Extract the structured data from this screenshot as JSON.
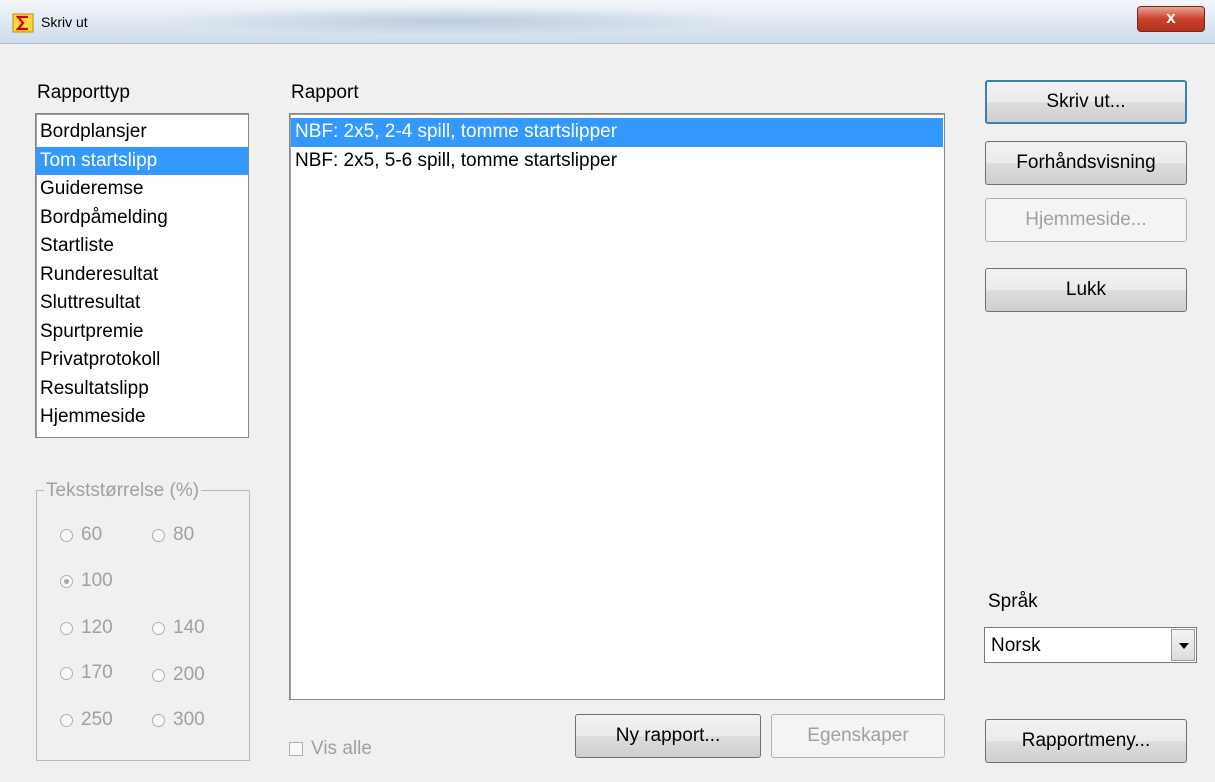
{
  "window": {
    "title": "Skriv ut",
    "close_glyph": "x",
    "icon": "sigma-icon"
  },
  "report_type": {
    "label": "Rapporttyp",
    "items": [
      "Bordplansjer",
      "Tom startslipp",
      "Guideremse",
      "Bordpåmelding",
      "Startliste",
      "Runderesultat",
      "Sluttresultat",
      "Spurtpremie",
      "Privatprotokoll",
      "Resultatslipp",
      "Hjemmeside"
    ],
    "selected": "Tom startslipp"
  },
  "report": {
    "label": "Rapport",
    "items": [
      "NBF: 2x5, 2-4 spill, tomme startslipper",
      "NBF: 2x5, 5-6 spill, tomme startslipper"
    ],
    "selected": "NBF: 2x5, 2-4 spill, tomme startslipper"
  },
  "text_size": {
    "label": "Tekststørrelse (%)",
    "options": [
      "60",
      "80",
      "100",
      "120",
      "140",
      "170",
      "200",
      "250",
      "300"
    ],
    "selected": "100"
  },
  "show_all": {
    "label": "Vis alle",
    "checked": false
  },
  "buttons": {
    "print": "Skriv ut...",
    "preview": "Forhåndsvisning",
    "homepage": "Hjemmeside...",
    "close": "Lukk",
    "new_report": "Ny rapport...",
    "properties": "Egenskaper",
    "report_menu": "Rapportmeny..."
  },
  "language": {
    "label": "Språk",
    "value": "Norsk"
  },
  "colors": {
    "selection": "#3399ff",
    "disabled_text": "#a0a0a0",
    "close_button": "#c8422d"
  }
}
